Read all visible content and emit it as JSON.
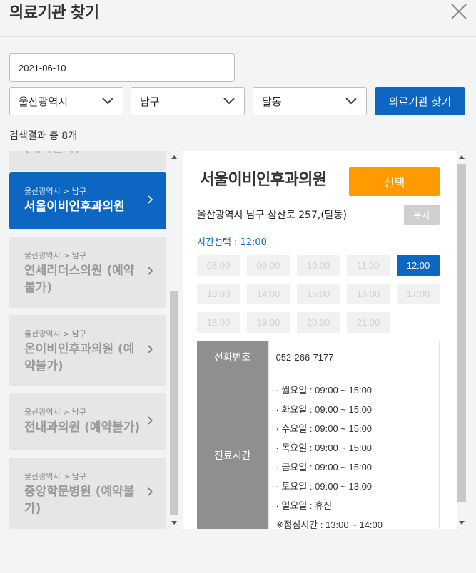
{
  "header": {
    "title": "의료기관 찾기"
  },
  "search": {
    "date_value": "2021-06-10",
    "city": "울산광역시",
    "district": "남구",
    "dong": "달동",
    "find_label": "의료기관 찾기"
  },
  "results": {
    "count_text": "검색결과 총 8개",
    "items": [
      {
        "region": "울산광역시 > 남구",
        "name": "서울이비인후과의원",
        "selected": true
      },
      {
        "region": "울산광역시 > 남구",
        "name": "연세리더스의원 (예약불가)"
      },
      {
        "region": "울산광역시 > 남구",
        "name": "온이비인후과의원 (예약불가)"
      },
      {
        "region": "울산광역시 > 남구",
        "name": "전내과의원 (예약불가)"
      },
      {
        "region": "울산광역시 > 남구",
        "name": "중앙학문병원 (예약불가)"
      }
    ]
  },
  "detail": {
    "name": "서울이비인후과의원",
    "select_label": "선택",
    "address": "울산광역시 남구 삼산로 257,(달동)",
    "copy_label": "복사",
    "time_label": "시간선택 : 12:00",
    "slots": [
      "08:00",
      "09:00",
      "10:00",
      "11:00",
      "12:00",
      "13:00",
      "14:00",
      "15:00",
      "16:00",
      "17:00",
      "18:00",
      "19:00",
      "20:00",
      "21:00"
    ],
    "selected_slot": "12:00",
    "phone_label": "전화번호",
    "phone": "052-266-7177",
    "hours_label": "진료시간",
    "hours": [
      "· 월요일 : 09:00 ~ 15:00",
      "· 화요일 : 09:00 ~ 15:00",
      "· 수요일 : 09:00 ~ 15:00",
      "· 목요일 : 09:00 ~ 15:00",
      "· 금요일 : 09:00 ~ 15:00",
      "· 토요일 : 09:00 ~ 13:00",
      "· 일요일 : 휴진",
      "※점심시간 : 13:00 ~ 14:00"
    ]
  }
}
